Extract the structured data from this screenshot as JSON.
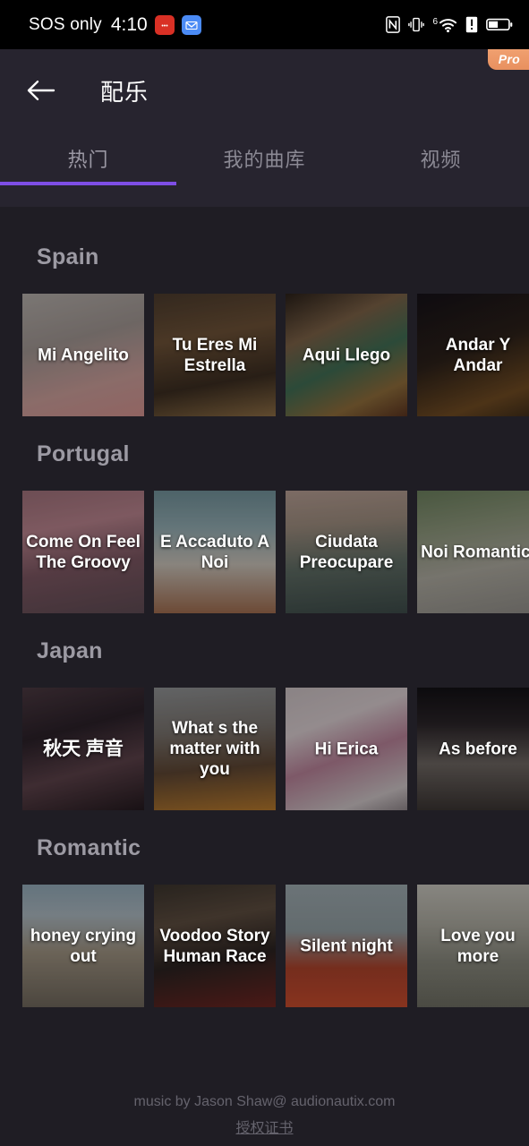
{
  "status_bar": {
    "carrier": "SOS only",
    "time": "4:10",
    "app_icons": [
      {
        "name": "app-icon-red",
        "color": "#d93025"
      },
      {
        "name": "app-icon-blue",
        "color": "#4b8bf5"
      }
    ],
    "right_icons": [
      "nfc-icon",
      "vibrate-icon",
      "wifi-6-icon",
      "alert-icon",
      "battery-icon"
    ],
    "wifi_generation": "6"
  },
  "header": {
    "back_label": "←",
    "title": "配乐",
    "pro_badge": "Pro",
    "tabs": [
      {
        "label": "热门",
        "active": true
      },
      {
        "label": "我的曲库",
        "active": false
      },
      {
        "label": "视频",
        "active": false
      }
    ],
    "indicator_color": "#7e4ee6"
  },
  "sections": [
    {
      "title": "Spain",
      "cards": [
        {
          "title": "Mi Angelito",
          "cjk": false,
          "art": "linear-gradient(165deg,#b0aaa6 0%,#9d938f 38%,#c79b97 72%,#cf8f8c 100%)"
        },
        {
          "title": "Tu Eres Mi Estrella",
          "cjk": false,
          "art": "linear-gradient(170deg,#4a3a2c 0%,#6b5036 35%,#3a2c20 70%,#8a6b43 100%)"
        },
        {
          "title": "Aqui Llego",
          "cjk": false,
          "art": "linear-gradient(155deg,#2a2019 0%,#7a6046 30%,#3f6b52 55%,#8c6b3a 80%,#59331f 100%)"
        },
        {
          "title": "Andar Y Andar",
          "cjk": false,
          "art": "linear-gradient(160deg,#151118 0%,#2b2019 45%,#6e4a22 80%,#3b2a18 100%)"
        }
      ]
    },
    {
      "title": "Portugal",
      "cards": [
        {
          "title": "Come On Feel The Groovy",
          "cjk": false,
          "art": "linear-gradient(170deg,#9c6f78 0%,#b4808a 30%,#7a5560 60%,#5d4a52 100%)"
        },
        {
          "title": "E Accaduto A Noi",
          "cjk": false,
          "art": "linear-gradient(180deg,#6f8e96 0%,#8fa8ae 30%,#c4bdb4 60%,#9c6a4d 100%)"
        },
        {
          "title": "Ciudata Preocupare",
          "cjk": false,
          "art": "linear-gradient(175deg,#b29a90 0%,#9a8a7c 28%,#5d6a62 60%,#3c4a48 100%)"
        },
        {
          "title": "Noi Romantici",
          "cjk": false,
          "art": "linear-gradient(170deg,#6a7e5c 0%,#8a9479 30%,#a9a69c 62%,#8e8b86 100%)"
        }
      ]
    },
    {
      "title": "Japan",
      "cards": [
        {
          "title": "秋天 声音",
          "cjk": true,
          "art": "linear-gradient(165deg,#4a3840 0%,#2a2028 35%,#5a4048 65%,#23191e 100%)"
        },
        {
          "title": "What s the matter with you",
          "cjk": false,
          "art": "linear-gradient(175deg,#8d8f91 0%,#76706b 35%,#5b4432 65%,#b2762c 100%)"
        },
        {
          "title": "Hi Erica",
          "cjk": false,
          "art": "linear-gradient(160deg,#c6bcbe 0%,#d4c8cb 30%,#b47f95 55%,#c9c0c2 85%,#8d8488 100%)"
        },
        {
          "title": "As before",
          "cjk": false,
          "art": "linear-gradient(180deg,#121014 0%,#2a2428 30%,#6b6460 62%,#3a3432 100%)"
        }
      ]
    },
    {
      "title": "Romantic",
      "cards": [
        {
          "title": "honey crying out",
          "cjk": false,
          "art": "linear-gradient(180deg,#8fa6b4 0%,#a8b4bc 25%,#9a8f7e 55%,#6d655a 100%)"
        },
        {
          "title": "Voodoo Story Human Race",
          "cjk": false,
          "art": "linear-gradient(170deg,#3a332c 0%,#5b4b3e 30%,#2a2220 60%,#6b2420 100%)"
        },
        {
          "title": "Silent night",
          "cjk": false,
          "art": "linear-gradient(180deg,#9aa6ab 0%,#8e9a9e 38%,#a8412a 68%,#c24a2c 100%)"
        },
        {
          "title": "Love you more",
          "cjk": false,
          "art": "linear-gradient(180deg,#c2c0b8 0%,#a8a69c 32%,#85857a 62%,#6b6b60 100%)"
        }
      ]
    }
  ],
  "footer": {
    "credit": "music by Jason Shaw@ audionautix.com",
    "link": "授权证书"
  }
}
